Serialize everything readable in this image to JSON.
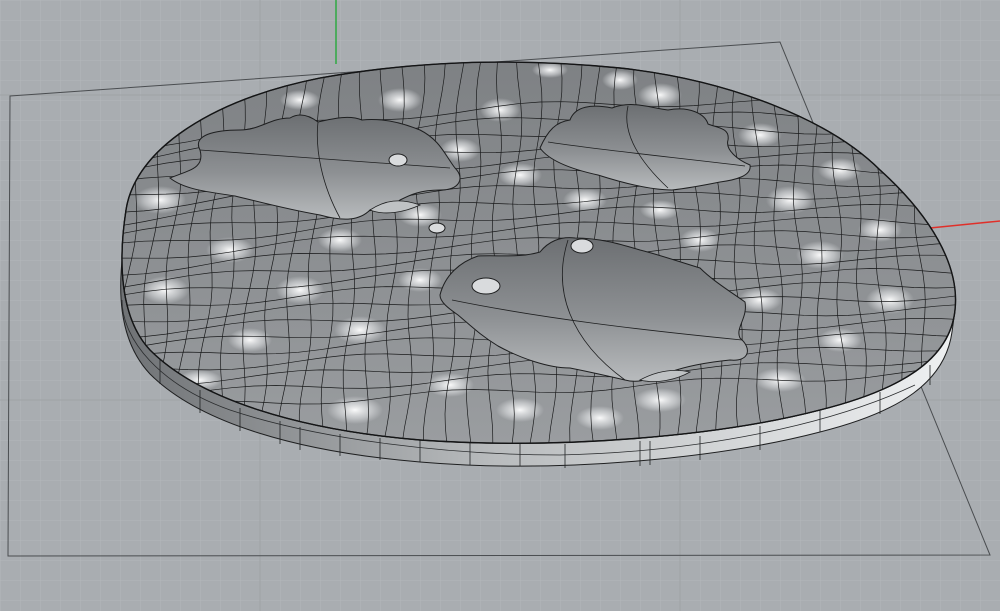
{
  "viewport": {
    "view_name": "",
    "display_mode": "",
    "background_color": "#a9adb1",
    "grid_minor_color": "#b6babd",
    "grid_major_color": "#9a9ea2",
    "x_axis_color": "#e0302a",
    "y_axis_color": "#26a83a"
  },
  "model": {
    "description_icon": "wavy-disc-with-leaf-recesses-model",
    "surface_color": "#8e9194",
    "surface_highlight": "#e4e6e8",
    "recess_count": 3,
    "hole_count": 5
  }
}
